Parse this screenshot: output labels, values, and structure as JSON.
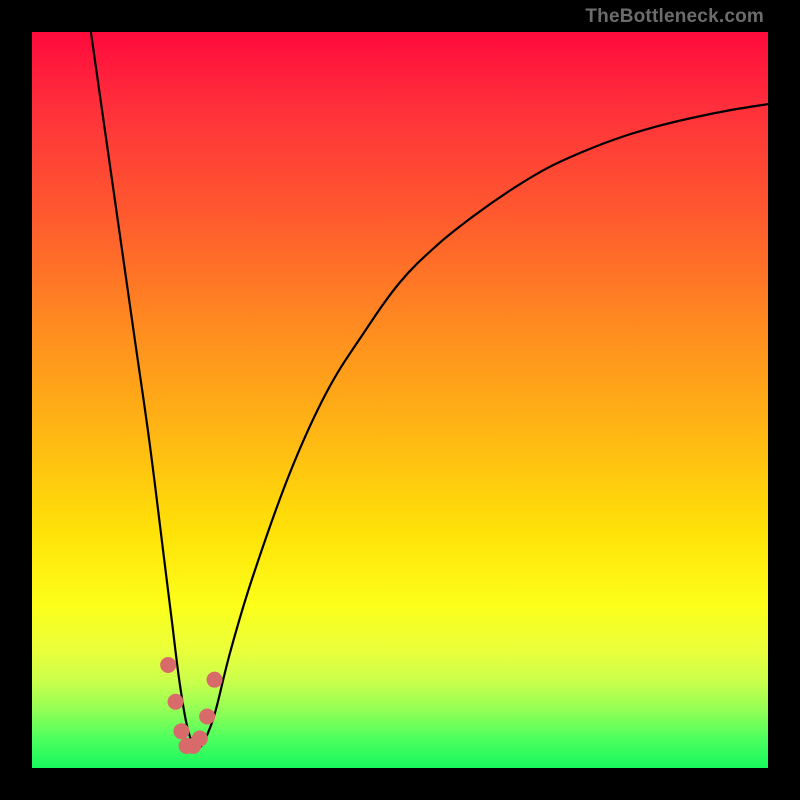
{
  "attribution": "TheBottleneck.com",
  "chart_data": {
    "type": "line",
    "title": "",
    "xlabel": "",
    "ylabel": "",
    "xlim": [
      0,
      100
    ],
    "ylim": [
      0,
      100
    ],
    "series": [
      {
        "name": "bottleneck-curve",
        "x": [
          8,
          10,
          12,
          14,
          16,
          18,
          19,
          20,
          21,
          22,
          23,
          24,
          25,
          27,
          30,
          35,
          40,
          45,
          50,
          55,
          60,
          65,
          70,
          75,
          80,
          85,
          90,
          95,
          100
        ],
        "values": [
          100,
          86,
          72,
          58,
          44,
          28,
          20,
          12,
          6,
          3,
          3,
          5,
          8,
          16,
          26,
          40,
          51,
          59,
          66,
          71,
          75,
          78.5,
          81.5,
          83.8,
          85.7,
          87.2,
          88.4,
          89.4,
          90.2
        ]
      }
    ],
    "markers": {
      "name": "highlight-dots",
      "color": "#d86a6a",
      "x": [
        18.5,
        19.5,
        20.3,
        21.0,
        21.9,
        22.8,
        23.8,
        24.8
      ],
      "values": [
        14,
        9,
        5,
        3,
        3,
        4,
        7,
        12
      ]
    },
    "gradient_stops": [
      {
        "pos": 0,
        "color": "#ff0a3c"
      },
      {
        "pos": 25,
        "color": "#ff5a2e"
      },
      {
        "pos": 55,
        "color": "#ffb813"
      },
      {
        "pos": 78,
        "color": "#fcff1a"
      },
      {
        "pos": 100,
        "color": "#18f85e"
      }
    ]
  }
}
